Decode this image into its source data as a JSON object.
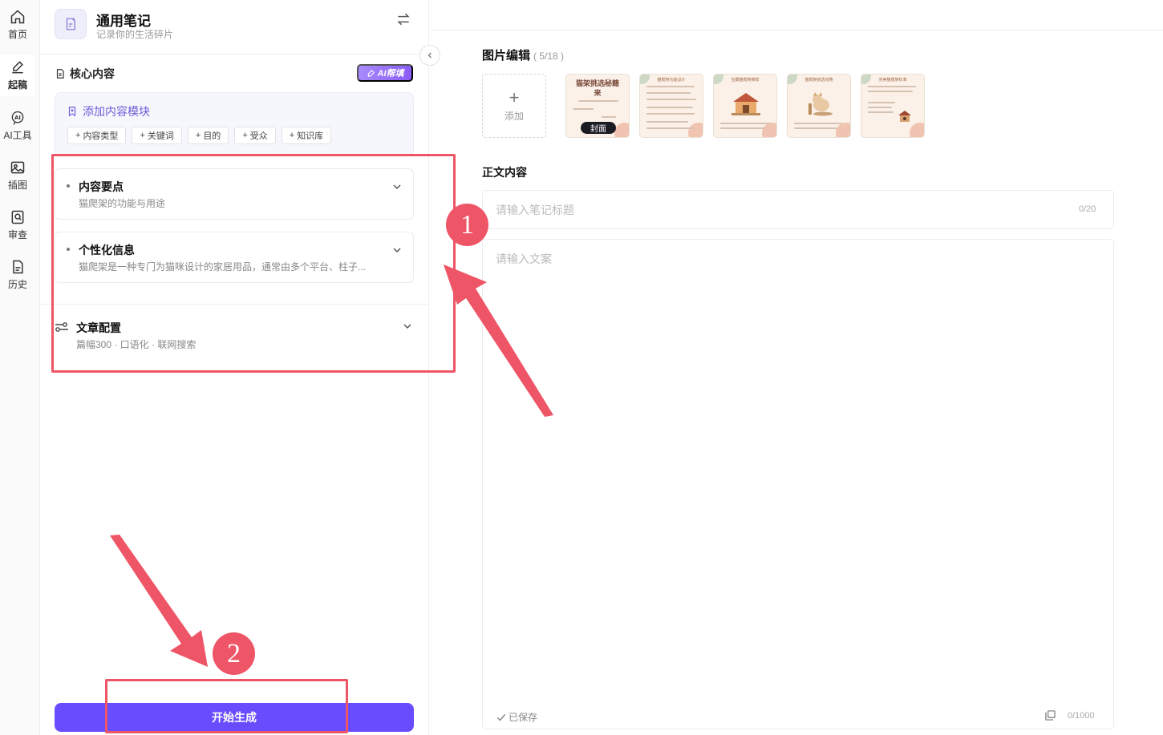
{
  "rail": {
    "items": [
      {
        "label": "首页"
      },
      {
        "label": "起稿"
      },
      {
        "label": "AI工具"
      },
      {
        "label": "插图"
      },
      {
        "label": "审查"
      },
      {
        "label": "历史"
      }
    ]
  },
  "panel": {
    "title": "通用笔记",
    "subtitle": "记录你的生活碎片",
    "section_title": "核心内容",
    "ai_button": "AI帮填",
    "add_module": "添加内容模块",
    "chips": [
      "内容类型",
      "关键词",
      "目的",
      "受众",
      "知识库"
    ],
    "cards": [
      {
        "title": "内容要点",
        "desc": "猫爬架的功能与用途"
      },
      {
        "title": "个性化信息",
        "desc": "猫爬架是一种专门为猫咪设计的家居用品，通常由多个平台、柱子..."
      }
    ],
    "config": {
      "title": "文章配置",
      "desc": "篇幅300 · 口语化 · 联网搜索"
    },
    "generate_button": "开始生成"
  },
  "editor": {
    "image_section_title": "图片编辑",
    "image_count": "( 5/18 )",
    "add_label": "添加",
    "cover_title": "猫架挑选秘籍来",
    "cover_badge": "封面",
    "thumb_titles": [
      "猫爬架功能设计",
      "宝藏猫爬架推荐",
      "猫爬架挑选攻略",
      "完美猫爬架标准"
    ],
    "body_title": "正文内容",
    "title_placeholder": "请输入笔记标题",
    "title_count": "0/20",
    "content_placeholder": "请输入文案",
    "saved_text": "已保存",
    "content_count": "0/1000"
  },
  "annotations": {
    "step1": "1",
    "step2": "2",
    "color": "#ee5566"
  },
  "colors": {
    "accent": "#6a4cff",
    "ai_button": "#8b5cf6",
    "annotation": "#ee5566"
  }
}
